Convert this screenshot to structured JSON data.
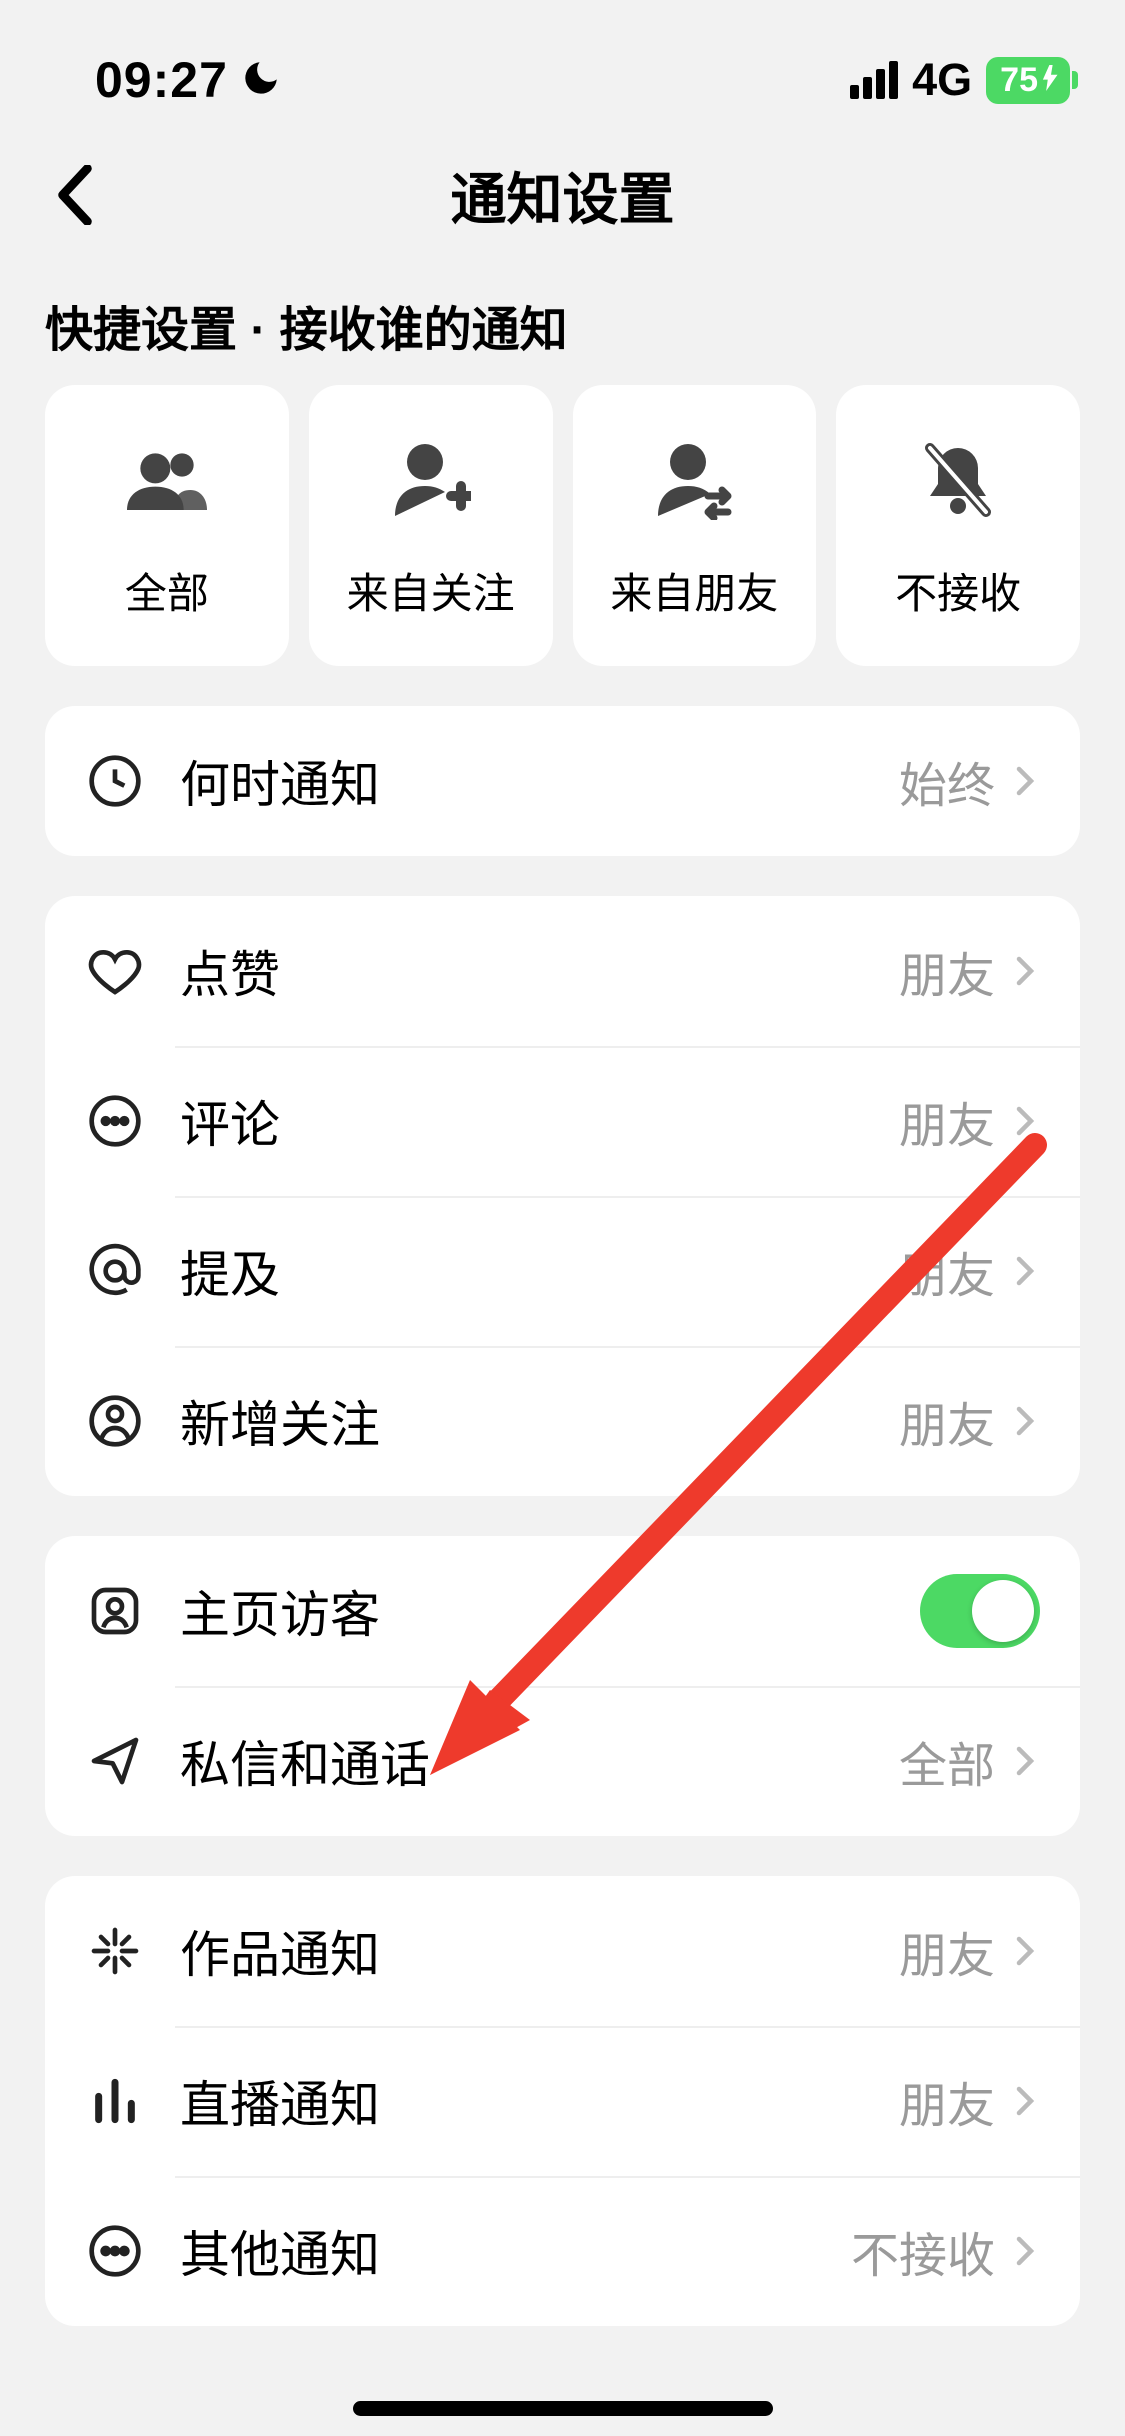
{
  "statusBar": {
    "time": "09:27",
    "network": "4G",
    "battery": "75"
  },
  "nav": {
    "title": "通知设置"
  },
  "sectionHeader": "快捷设置 · 接收谁的通知",
  "quick": [
    {
      "label": "全部"
    },
    {
      "label": "来自关注"
    },
    {
      "label": "来自朋友"
    },
    {
      "label": "不接收"
    }
  ],
  "group1": [
    {
      "label": "何时通知",
      "value": "始终"
    }
  ],
  "group2": [
    {
      "label": "点赞",
      "value": "朋友"
    },
    {
      "label": "评论",
      "value": "朋友"
    },
    {
      "label": "提及",
      "value": "朋友"
    },
    {
      "label": "新增关注",
      "value": "朋友"
    }
  ],
  "group3": [
    {
      "label": "主页访客",
      "toggle": true
    },
    {
      "label": "私信和通话",
      "value": "全部"
    }
  ],
  "group4": [
    {
      "label": "作品通知",
      "value": "朋友"
    },
    {
      "label": "直播通知",
      "value": "朋友"
    },
    {
      "label": "其他通知",
      "value": "不接收"
    }
  ]
}
